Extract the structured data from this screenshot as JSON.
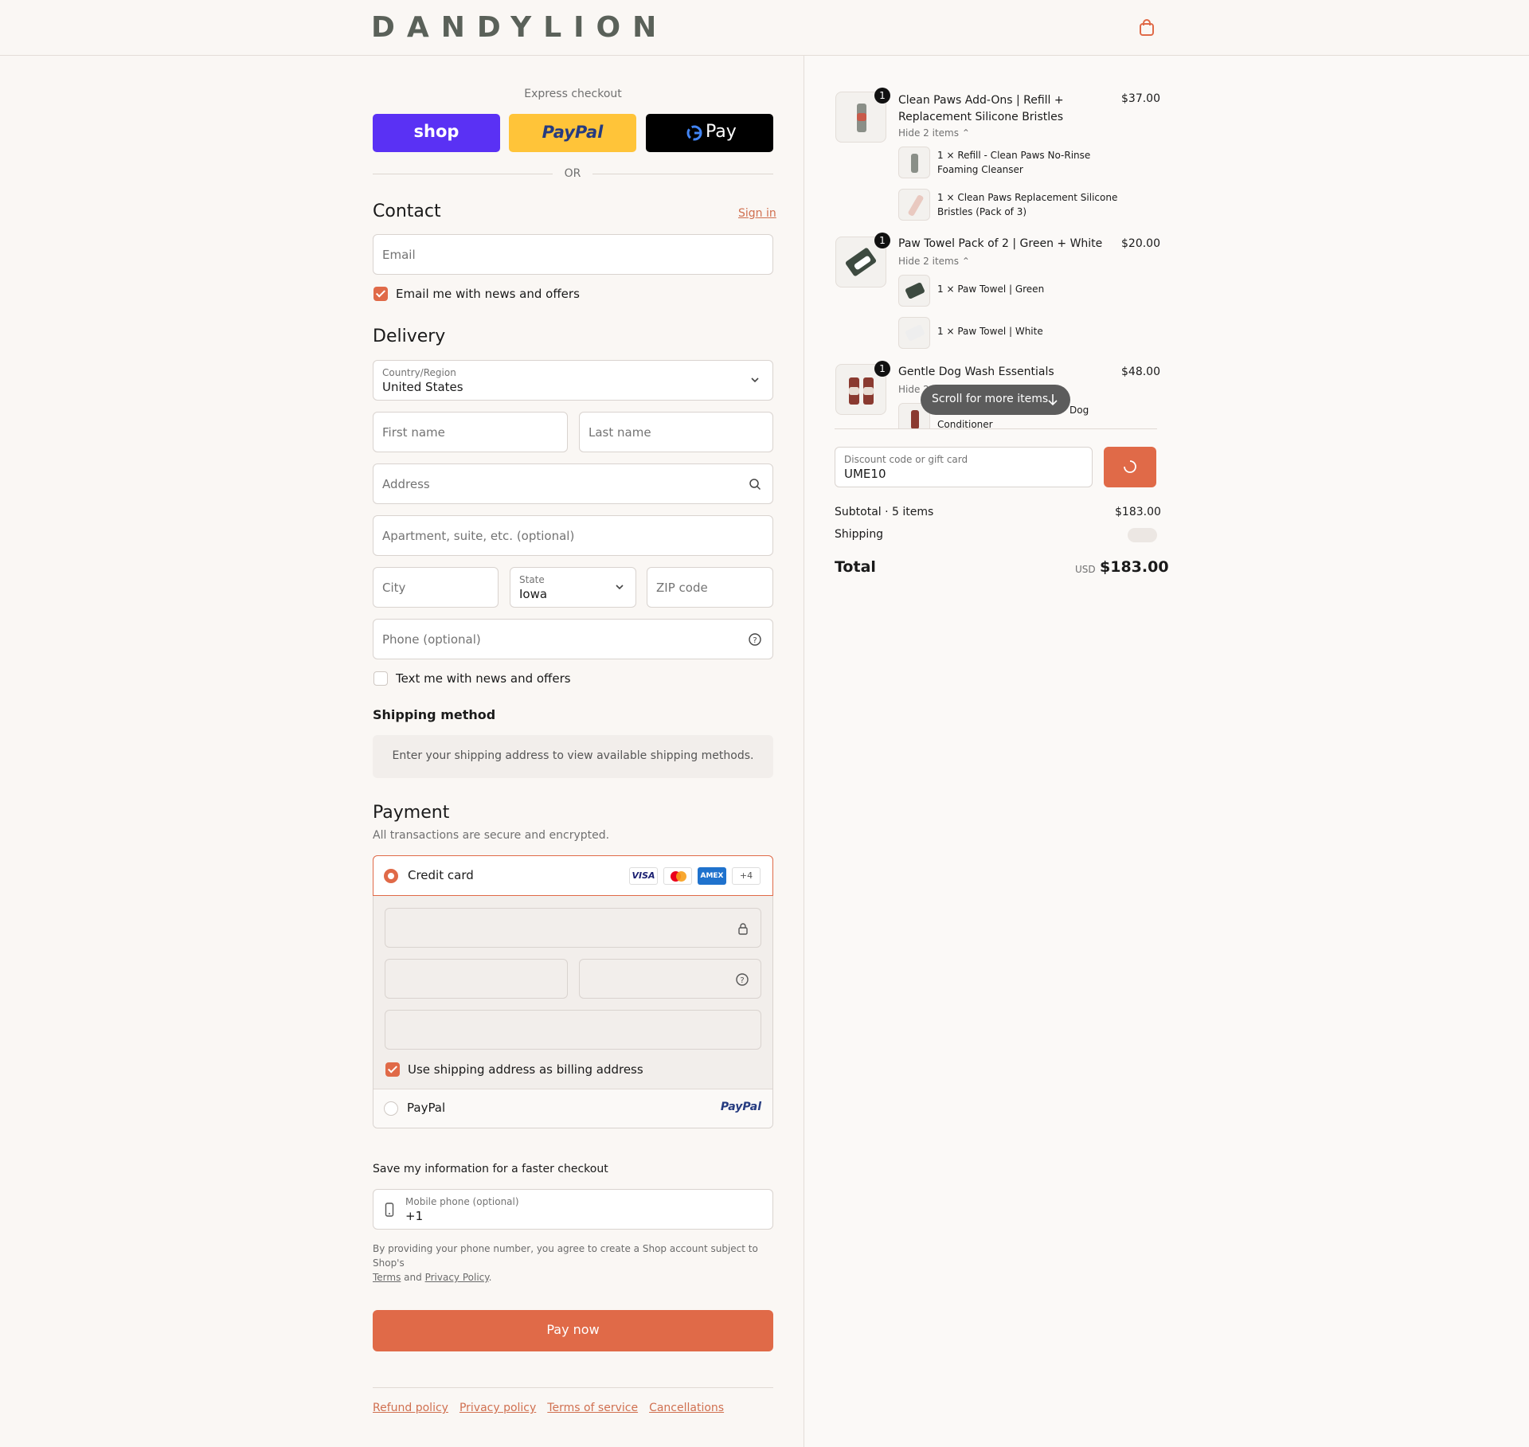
{
  "brand": {
    "name": "DANDYLION"
  },
  "express": {
    "label": "Express checkout",
    "shop": "shop",
    "paypal": "PayPal",
    "gpay": "Pay",
    "or": "OR"
  },
  "contact": {
    "title": "Contact",
    "sign_in": "Sign in",
    "email_placeholder": "Email",
    "news_label": "Email me with news and offers"
  },
  "delivery": {
    "title": "Delivery",
    "country_label": "Country/Region",
    "country_value": "United States",
    "first_name": "First name",
    "last_name": "Last name",
    "address": "Address",
    "apartment": "Apartment, suite, etc. (optional)",
    "city": "City",
    "state_label": "State",
    "state_value": "Iowa",
    "zip": "ZIP code",
    "phone": "Phone (optional)",
    "text_label": "Text me with news and offers"
  },
  "shipping_method": {
    "title": "Shipping method",
    "notice": "Enter your shipping address to view available shipping methods."
  },
  "payment": {
    "title": "Payment",
    "subtitle": "All transactions are secure and encrypted.",
    "credit_card": "Credit card",
    "cards": [
      "VISA",
      "MC",
      "AMEX",
      "+4"
    ],
    "billing_label": "Use shipping address as billing address",
    "paypal": "PayPal",
    "paypal_logo": "PayPal"
  },
  "save_info": {
    "title": "Save my information for a faster checkout",
    "mobile_label": "Mobile phone (optional)",
    "mobile_value": "+1",
    "disclaimer_1": "By providing your phone number, you agree to create a Shop account subject to Shop's",
    "terms": "Terms",
    "and": "and",
    "privacy": "Privacy Policy",
    "period": "."
  },
  "pay_now": "Pay now",
  "footer_links": [
    "Refund policy",
    "Privacy policy",
    "Terms of service",
    "Cancellations"
  ],
  "cart": {
    "items": [
      {
        "qty": "1",
        "title_1": "Clean Paws Add-Ons | Refill +",
        "title_2": "Replacement Silicone Bristles",
        "price": "$37.00",
        "hide": "Hide 2 items",
        "subs": [
          [
            "1 × Refill - Clean Paws No-Rinse",
            "Foaming Cleanser"
          ],
          [
            "1 × Clean Paws Replacement Silicone",
            "Bristles (Pack of 3)"
          ]
        ]
      },
      {
        "qty": "1",
        "title_1": "Paw Towel Pack of 2 | Green + White",
        "price": "$20.00",
        "hide": "Hide 2 items",
        "subs": [
          [
            "1 × Paw Towel | Green"
          ],
          [
            "1 × Paw Towel | White"
          ]
        ]
      },
      {
        "qty": "1",
        "title_1": "Gentle Dog Wash Essentials",
        "price": "$48.00",
        "hide": "Hide 2",
        "subs": [
          [
            "Dog",
            "Conditioner"
          ]
        ]
      }
    ],
    "scroll_hint": "Scroll for more items",
    "discount_label": "Discount code or gift card",
    "discount_value": "UME10",
    "subtotal_label": "Subtotal · 5 items",
    "subtotal_value": "$183.00",
    "shipping_label": "Shipping",
    "total_label": "Total",
    "currency": "USD",
    "total_value": "$183.00"
  },
  "colors": {
    "accent": "#e06a48",
    "shop": "#5a31f4",
    "paypal": "#ffc439",
    "gpay": "#000000"
  }
}
